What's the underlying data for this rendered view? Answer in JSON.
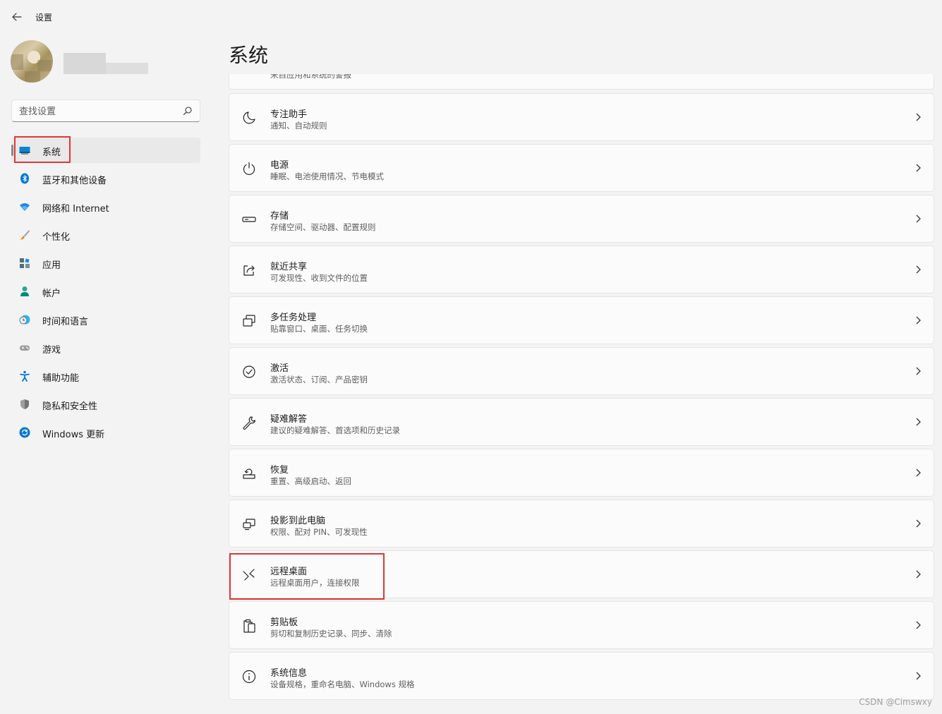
{
  "window": {
    "title": "设置"
  },
  "search": {
    "placeholder": "查找设置"
  },
  "sidebar": {
    "items": [
      {
        "label": "系统",
        "icon": "system-display-icon",
        "active": true
      },
      {
        "label": "蓝牙和其他设备",
        "icon": "bluetooth-icon"
      },
      {
        "label": "网络和 Internet",
        "icon": "wifi-icon"
      },
      {
        "label": "个性化",
        "icon": "paintbrush-icon"
      },
      {
        "label": "应用",
        "icon": "apps-grid-icon"
      },
      {
        "label": "帐户",
        "icon": "person-icon"
      },
      {
        "label": "时间和语言",
        "icon": "clock-globe-icon"
      },
      {
        "label": "游戏",
        "icon": "gamepad-icon"
      },
      {
        "label": "辅助功能",
        "icon": "accessibility-icon"
      },
      {
        "label": "隐私和安全性",
        "icon": "shield-icon"
      },
      {
        "label": "Windows 更新",
        "icon": "update-icon"
      }
    ]
  },
  "page": {
    "title": "系统"
  },
  "partial_card": {
    "subtitle": "来自应用和系统的警报"
  },
  "cards": [
    {
      "title": "专注助手",
      "subtitle": "通知、自动规则",
      "icon": "moon-icon"
    },
    {
      "title": "电源",
      "subtitle": "睡眠、电池使用情况、节电模式",
      "icon": "power-icon"
    },
    {
      "title": "存储",
      "subtitle": "存储空间、驱动器、配置规则",
      "icon": "storage-drive-icon"
    },
    {
      "title": "就近共享",
      "subtitle": "可发现性、收到文件的位置",
      "icon": "share-icon"
    },
    {
      "title": "多任务处理",
      "subtitle": "贴靠窗口、桌面、任务切换",
      "icon": "multitask-icon"
    },
    {
      "title": "激活",
      "subtitle": "激活状态、订阅、产品密钥",
      "icon": "check-circle-icon"
    },
    {
      "title": "疑难解答",
      "subtitle": "建议的疑难解答、首选项和历史记录",
      "icon": "wrench-icon"
    },
    {
      "title": "恢复",
      "subtitle": "重置、高级启动、返回",
      "icon": "recovery-icon"
    },
    {
      "title": "投影到此电脑",
      "subtitle": "权限、配对 PIN、可发现性",
      "icon": "project-icon"
    },
    {
      "title": "远程桌面",
      "subtitle": "远程桌面用户，连接权限",
      "icon": "remote-desktop-icon"
    },
    {
      "title": "剪贴板",
      "subtitle": "剪切和复制历史记录、同步、清除",
      "icon": "clipboard-icon"
    },
    {
      "title": "系统信息",
      "subtitle": "设备规格，重命名电脑、Windows 规格",
      "icon": "info-icon"
    }
  ],
  "watermark": "CSDN @Cimswxy",
  "colors": {
    "highlight": "#e0363a",
    "accent": "#0067c0",
    "background": "#f3f3f3"
  }
}
